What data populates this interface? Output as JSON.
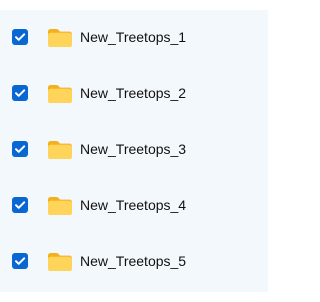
{
  "items": [
    {
      "label": "New_Treetops_1",
      "checked": true,
      "icon": "folder-icon"
    },
    {
      "label": "New_Treetops_2",
      "checked": true,
      "icon": "folder-icon"
    },
    {
      "label": "New_Treetops_3",
      "checked": true,
      "icon": "folder-icon"
    },
    {
      "label": "New_Treetops_4",
      "checked": true,
      "icon": "folder-icon"
    },
    {
      "label": "New_Treetops_5",
      "checked": true,
      "icon": "folder-icon"
    }
  ],
  "colors": {
    "checkbox": "#0867d2",
    "folder_back": "#f3b21b",
    "folder_front": "#ffd45a",
    "panel_bg": "#f3f8fc"
  }
}
